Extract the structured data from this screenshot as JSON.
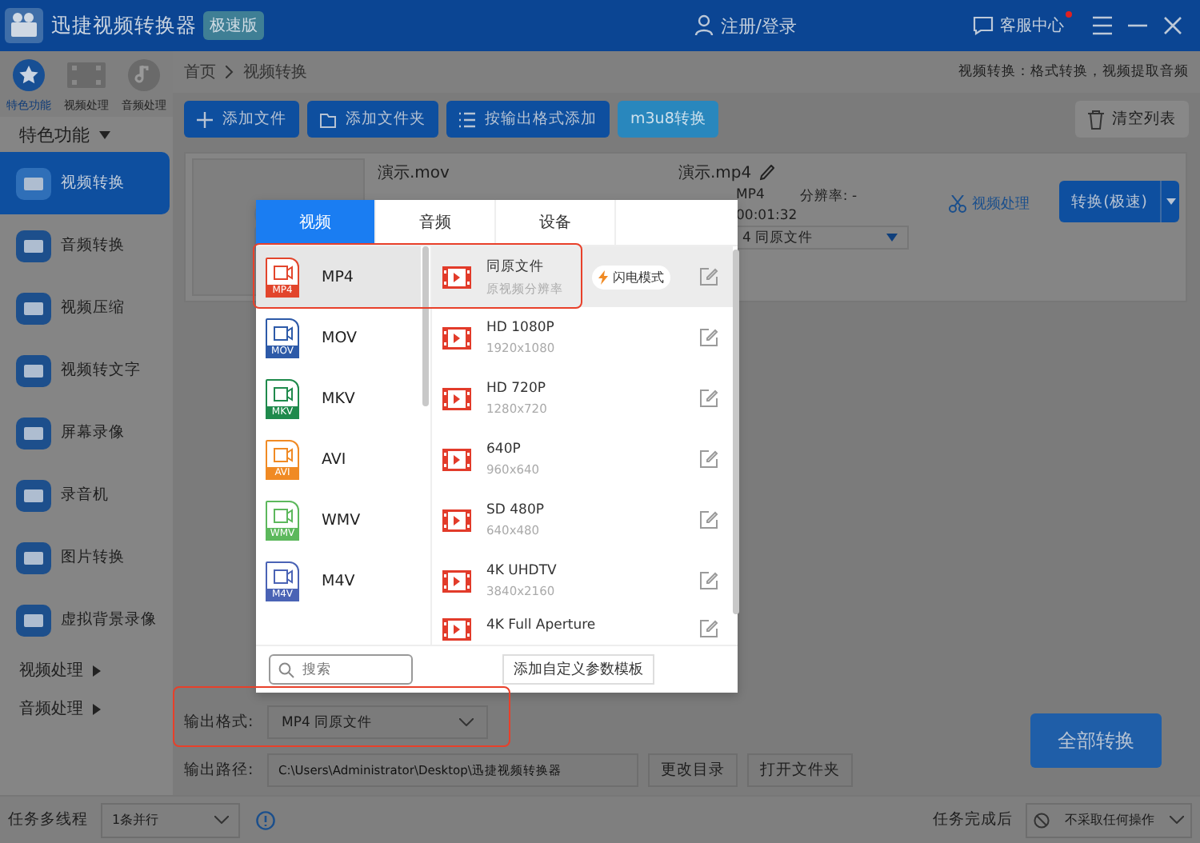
{
  "title_bar": {
    "app_name": "迅捷视频转换器",
    "badge": "极速版",
    "login": "注册/登录",
    "support": "客服中心",
    "support_unread": true
  },
  "sidebar": {
    "tabs": [
      {
        "label": "特色功能",
        "selected": true
      },
      {
        "label": "视频处理",
        "selected": false
      },
      {
        "label": "音频处理",
        "selected": false
      }
    ],
    "section": "特色功能",
    "items": [
      {
        "label": "视频转换",
        "selected": true
      },
      {
        "label": "音频转换",
        "selected": false
      },
      {
        "label": "视频压缩",
        "selected": false
      },
      {
        "label": "视频转文字",
        "selected": false
      },
      {
        "label": "屏幕录像",
        "selected": false
      },
      {
        "label": "录音机",
        "selected": false
      },
      {
        "label": "图片转换",
        "selected": false
      },
      {
        "label": "虚拟背景录像",
        "selected": false
      }
    ],
    "groups": [
      "视频处理",
      "音频处理"
    ]
  },
  "breadcrumb": [
    "首页",
    "视频转换"
  ],
  "page_hint": "视频转换：格式转换，视频提取音频",
  "toolbar": {
    "buttons": [
      {
        "label": "添加文件",
        "kind": "primary"
      },
      {
        "label": "添加文件夹",
        "kind": "primary"
      },
      {
        "label": "按输出格式添加",
        "kind": "primary"
      },
      {
        "label": "m3u8转换",
        "kind": "accent"
      }
    ],
    "clear": "清空列表"
  },
  "file": {
    "source_name": "演示.mov",
    "output_name": "演示.mp4",
    "format": "MP4",
    "resolution": "分辨率: -",
    "duration": "00:01:32",
    "preset": "4  同原文件",
    "edit": "视频处理",
    "convert": "转换(极速)"
  },
  "format_picker": {
    "tabs": [
      {
        "label": "视频",
        "selected": true
      },
      {
        "label": "音频",
        "selected": false
      },
      {
        "label": "设备",
        "selected": false
      }
    ],
    "formats": [
      {
        "label": "MP4",
        "badge": "MP4",
        "color": "#e2452c",
        "selected": true
      },
      {
        "label": "MOV",
        "badge": "MOV",
        "color": "#2d5aa8",
        "selected": false
      },
      {
        "label": "MKV",
        "badge": "MKV",
        "color": "#1f8a4c",
        "selected": false
      },
      {
        "label": "AVI",
        "badge": "AVI",
        "color": "#f08a24",
        "selected": false
      },
      {
        "label": "WMV",
        "badge": "WMV",
        "color": "#5cb85c",
        "selected": false
      },
      {
        "label": "M4V",
        "badge": "M4V",
        "color": "#4a63b5",
        "selected": false
      }
    ],
    "presets": [
      {
        "name": "同原文件",
        "detail": "原视频分辨率",
        "fast_mode": "闪电模式",
        "selected": true
      },
      {
        "name": "HD 1080P",
        "detail": "1920x1080",
        "selected": false
      },
      {
        "name": "HD 720P",
        "detail": "1280x720",
        "selected": false
      },
      {
        "name": "640P",
        "detail": "960x640",
        "selected": false
      },
      {
        "name": "SD 480P",
        "detail": "640x480",
        "selected": false
      },
      {
        "name": "4K UHDTV",
        "detail": "3840x2160",
        "selected": false
      },
      {
        "name": "4K Full Aperture",
        "selected": false
      }
    ],
    "search_placeholder": "搜索",
    "add_template": "添加自定义参数模板"
  },
  "output": {
    "format_label": "输出格式:",
    "format_value": "MP4  同原文件",
    "path_label": "输出路径:",
    "path": "C:\\Users\\Administrator\\Desktop\\迅捷视频转换器",
    "change_dir": "更改目录",
    "open_folder": "打开文件夹",
    "convert_all": "全部转换"
  },
  "status_bar": {
    "threads_label": "任务多线程",
    "threads": "1条并行",
    "after_label": "任务完成后",
    "after": "不采取任何操作"
  }
}
